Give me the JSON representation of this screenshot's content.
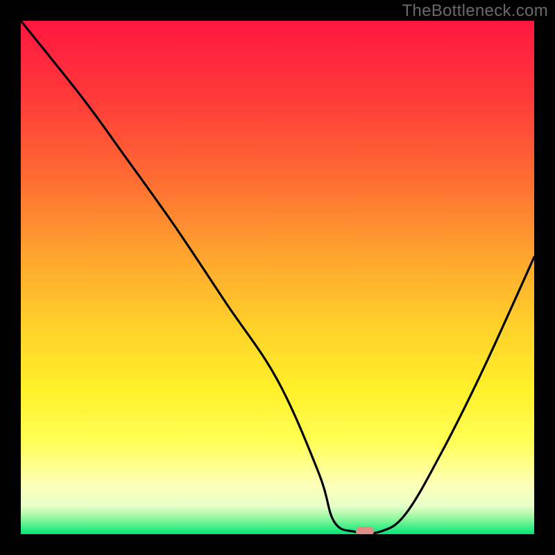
{
  "watermark": "TheBottleneck.com",
  "colors": {
    "frame_bg": "#000000",
    "curve_stroke": "#000000",
    "marker_fill": "#e08e85",
    "gradient_stops": [
      {
        "offset": 0.0,
        "color": "#ff163f"
      },
      {
        "offset": 0.15,
        "color": "#ff3a3a"
      },
      {
        "offset": 0.3,
        "color": "#ff6a33"
      },
      {
        "offset": 0.45,
        "color": "#ffa22e"
      },
      {
        "offset": 0.6,
        "color": "#ffd22a"
      },
      {
        "offset": 0.72,
        "color": "#fff02a"
      },
      {
        "offset": 0.82,
        "color": "#ffff55"
      },
      {
        "offset": 0.9,
        "color": "#ffffb5"
      },
      {
        "offset": 0.945,
        "color": "#e8ffc8"
      },
      {
        "offset": 0.97,
        "color": "#8ef79d"
      },
      {
        "offset": 1.0,
        "color": "#00e676"
      }
    ]
  },
  "chart_data": {
    "type": "line",
    "title": "",
    "xlabel": "",
    "ylabel": "",
    "xlim": [
      0,
      100
    ],
    "ylim": [
      0,
      100
    ],
    "grid": false,
    "series": [
      {
        "name": "bottleneck-curve",
        "x": [
          0,
          12,
          20,
          30,
          40,
          50,
          58,
          61,
          65,
          70,
          75,
          82,
          90,
          100
        ],
        "y": [
          100,
          85,
          74,
          60,
          45,
          30,
          12,
          2.5,
          0.5,
          0.5,
          4,
          16,
          32,
          54
        ]
      }
    ],
    "highlight_marker": {
      "x": 67,
      "y": 0.5
    }
  }
}
